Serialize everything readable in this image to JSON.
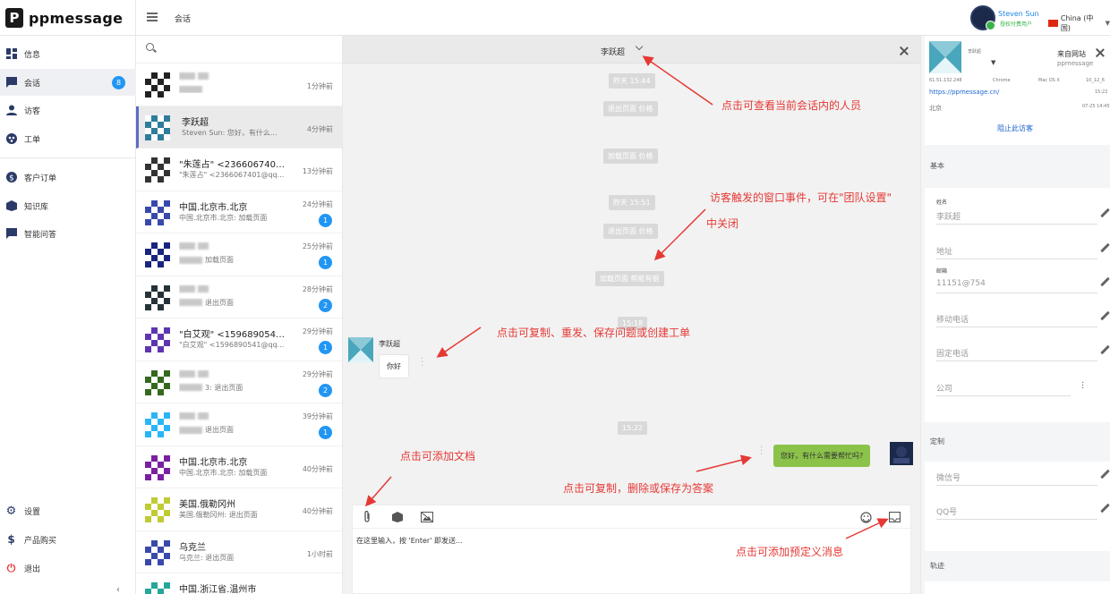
{
  "app": {
    "brand": "ppmessage",
    "page_title": "会话"
  },
  "user": {
    "name": "Steven Sun",
    "role": "授权付费用户",
    "language": "China (中国)"
  },
  "sidebar": {
    "items": [
      {
        "label": "信息",
        "icon": "dashboard-icon"
      },
      {
        "label": "会话",
        "icon": "chat-icon",
        "badge": "8"
      },
      {
        "label": "访客",
        "icon": "person-icon"
      },
      {
        "label": "工单",
        "icon": "ticket-icon"
      },
      {
        "label": "客户订单",
        "icon": "dollar-icon"
      },
      {
        "label": "知识库",
        "icon": "knowledge-icon"
      },
      {
        "label": "智能问答",
        "icon": "qa-icon"
      }
    ],
    "bottom": [
      {
        "label": "设置",
        "icon": "gear-icon"
      },
      {
        "label": "产品购买",
        "icon": "dollar-sign-icon"
      },
      {
        "label": "退出",
        "icon": "power-icon"
      }
    ]
  },
  "conversations": [
    {
      "name": "",
      "preview": "",
      "time": "1分钟前",
      "badge": "",
      "blur": true,
      "color": "#222"
    },
    {
      "name": "李跃超",
      "preview": "Steven Sun: 您好，有什么...",
      "time": "4分钟前",
      "badge": "",
      "active": true,
      "color": "#2e7d9a"
    },
    {
      "name": "\"朱莲占\" <2366067401...",
      "preview": "\"朱莲占\" <2366067401@qq...",
      "time": "13分钟前",
      "badge": "",
      "color": "#333"
    },
    {
      "name": "中国.北京市.北京",
      "preview": "中国.北京市.北京: 加载页面",
      "time": "24分钟前",
      "badge": "1",
      "color": "#3949ab"
    },
    {
      "name": "",
      "preview": "加载页面",
      "time": "25分钟前",
      "badge": "1",
      "blur": true,
      "color": "#1a237e"
    },
    {
      "name": "",
      "preview": "退出页面",
      "time": "28分钟前",
      "badge": "2",
      "blur": true,
      "color": "#263238"
    },
    {
      "name": "\"白艾观\" <1596890541...",
      "preview": "\"白艾观\" <1596890541@qq...",
      "time": "29分钟前",
      "badge": "1",
      "color": "#5e35b1"
    },
    {
      "name": "",
      "preview": "3: 退出页面",
      "time": "29分钟前",
      "badge": "2",
      "blur": true,
      "color": "#33691e"
    },
    {
      "name": "",
      "preview": "退出页面",
      "time": "39分钟前",
      "badge": "1",
      "blur": true,
      "color": "#29b6f6"
    },
    {
      "name": "中国.北京市.北京",
      "preview": "中国.北京市.北京: 加载页面",
      "time": "40分钟前",
      "badge": "",
      "color": "#7b1fa2"
    },
    {
      "name": "美国.俄勒冈州",
      "preview": "美国.俄勒冈州: 退出页面",
      "time": "40分钟前",
      "badge": "",
      "color": "#c0ca33"
    },
    {
      "name": "乌克兰",
      "preview": "乌克兰: 退出页面",
      "time": "1小时前",
      "badge": "",
      "color": "#3949ab"
    },
    {
      "name": "中国.浙江省.温州市",
      "preview": "",
      "time": "",
      "badge": "",
      "color": "#26a69a"
    }
  ],
  "chat": {
    "title": "李跃超",
    "events": [
      "昨天 15:44",
      "退出页面 价格",
      "加载页面 价格",
      "昨天 15:51",
      "退出页面 价格",
      "加载页面 帮能有据",
      "15:18",
      "15:22"
    ],
    "incoming": {
      "sender": "李跃超",
      "text": "你好"
    },
    "outgoing": {
      "text": "您好，有什么需要帮忙吗?"
    },
    "composer_placeholder": "在这里输入，按 'Enter' 即发送..."
  },
  "annotations": [
    "点击可查看当前会话内的人员",
    "访客触发的窗口事件，可在\"团队设置\"",
    "中关闭",
    "点击可复制、重发、保存问题或创建工单",
    "点击可添加文档",
    "点击可复制，删除或保存为答案",
    "点击可添加预定义消息"
  ],
  "visitor": {
    "name_small": "李跃超",
    "ip": "61.51.132.248",
    "browser": "Chrome",
    "os": "Mac OS X",
    "os_version": "10_12_6",
    "url": "https://ppmessage.cn/",
    "time": "15:22",
    "location": "北京",
    "date": "07-25 14:45",
    "source_title": "来自网站",
    "source_sub": "ppmessage",
    "block": "阻止此访客"
  },
  "basic": {
    "title": "基本",
    "fields": [
      {
        "label": "姓名",
        "value": "李跃超"
      },
      {
        "label": "",
        "value": "地址"
      },
      {
        "label": "邮箱",
        "value": "11151@754"
      },
      {
        "label": "",
        "value": "移动电话"
      },
      {
        "label": "",
        "value": "固定电话"
      },
      {
        "label": "",
        "value": "公司"
      }
    ]
  },
  "custom": {
    "title": "定制",
    "fields": [
      "微信号",
      "QQ号"
    ]
  },
  "track": {
    "title": "轨迹"
  }
}
